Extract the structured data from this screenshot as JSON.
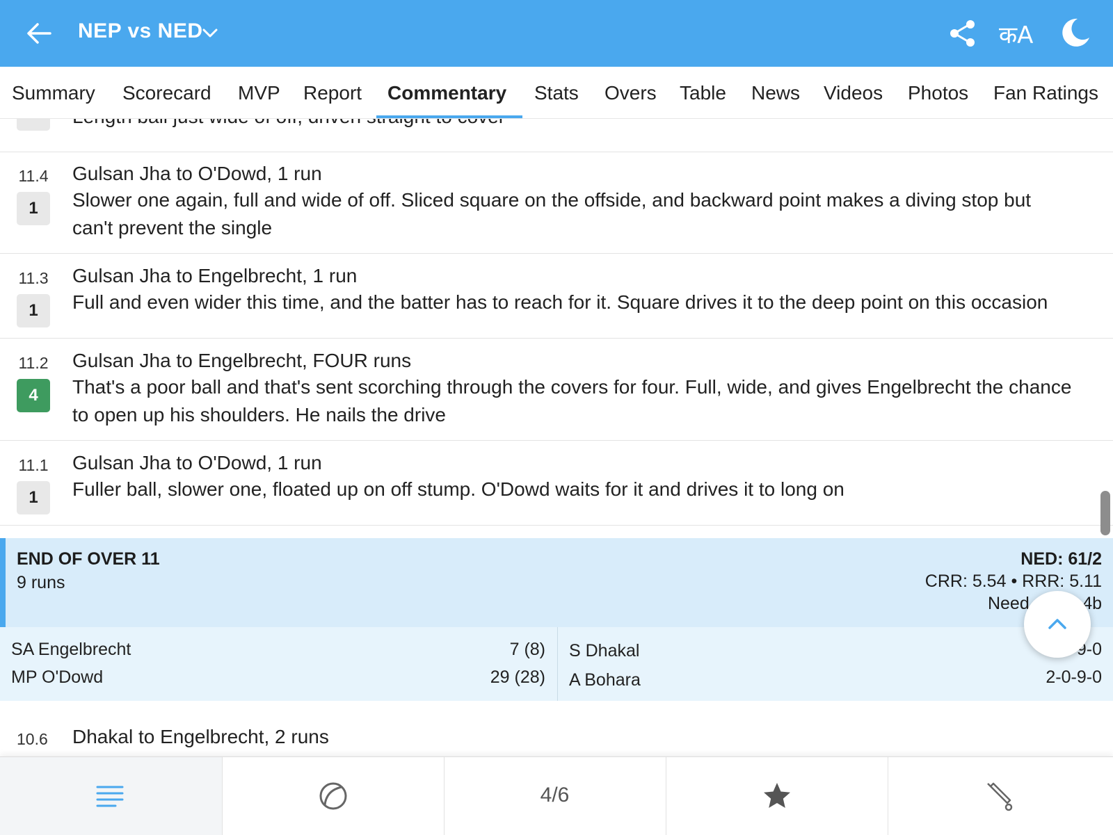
{
  "header": {
    "title": "NEP vs NED",
    "lang_label": "कA",
    "colors": {
      "brand": "#4aa8ee",
      "four_badge": "#3e9b5f",
      "summary_bg": "#d8ecfa"
    }
  },
  "tabs": [
    {
      "label": "Summary"
    },
    {
      "label": "Scorecard"
    },
    {
      "label": "MVP"
    },
    {
      "label": "Report"
    },
    {
      "label": "Commentary",
      "active": true
    },
    {
      "label": "Stats"
    },
    {
      "label": "Overs"
    },
    {
      "label": "Table"
    },
    {
      "label": "News"
    },
    {
      "label": "Videos"
    },
    {
      "label": "Photos"
    },
    {
      "label": "Fan Ratings"
    }
  ],
  "commentary": {
    "partial_top": {
      "badge": "•",
      "desc": "Length ball just wide of off, driven straight to cover"
    },
    "balls": [
      {
        "over": "11.4",
        "badge": "1",
        "headline": "Gulsan Jha to O'Dowd, 1 run",
        "desc": "Slower one again, full and wide of off. Sliced square on the offside, and backward point makes a diving stop but can't prevent the single"
      },
      {
        "over": "11.3",
        "badge": "1",
        "headline": "Gulsan Jha to Engelbrecht, 1 run",
        "desc": "Full and even wider this time, and the batter has to reach for it. Square drives it to the deep point on this occasion"
      },
      {
        "over": "11.2",
        "badge": "4",
        "headline": "Gulsan Jha to Engelbrecht, FOUR runs",
        "desc": "That's a poor ball and that's sent scorching through the covers for four. Full, wide, and gives Engelbrecht the chance to open up his shoulders. He nails the drive"
      },
      {
        "over": "11.1",
        "badge": "1",
        "headline": "Gulsan Jha to O'Dowd, 1 run",
        "desc": "Fuller ball, slower one, floated up on off stump. O'Dowd waits for it and drives it to long on"
      }
    ],
    "next_ball": {
      "over": "10.6",
      "headline": "Dhakal to Engelbrecht, 2 runs"
    }
  },
  "end_of_over": {
    "label": "END OF OVER 11",
    "runs": "9 runs",
    "score": "NED: 61/2",
    "rates": "CRR: 5.54 • RRR: 5.11",
    "need": "Need 46",
    "need_tail": "4b"
  },
  "batters": [
    {
      "name": "SA Engelbrecht",
      "stat": "7 (8)"
    },
    {
      "name": "MP O'Dowd",
      "stat": "29 (28)"
    }
  ],
  "bowlers": [
    {
      "name": "S Dhakal",
      "stat": "9-0"
    },
    {
      "name": "A Bohara",
      "stat": "2-0-9-0"
    }
  ],
  "bottom_nav": {
    "pager": "4/6"
  }
}
